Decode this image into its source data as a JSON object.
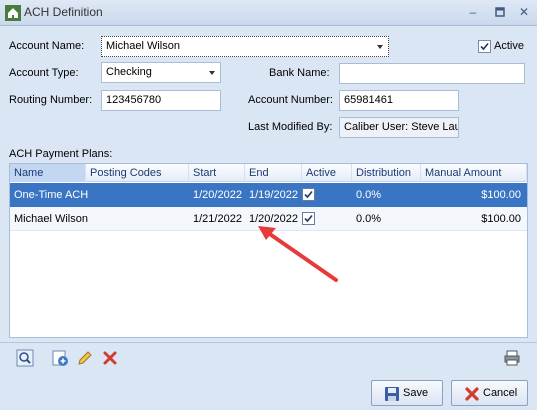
{
  "window": {
    "title": "ACH Definition",
    "minimize_glyph": "–",
    "maximize_glyph": "▫",
    "close_glyph": "✕"
  },
  "form": {
    "account_name_label": "Account Name:",
    "account_name_value": "Michael Wilson",
    "active_label": "Active",
    "active_checked": true,
    "account_type_label": "Account Type:",
    "account_type_value": "Checking",
    "bank_name_label": "Bank Name:",
    "bank_name_value": "",
    "routing_label": "Routing Number:",
    "routing_value": "123456780",
    "account_number_label": "Account Number:",
    "account_number_value": "65981461",
    "last_modified_label": "Last Modified By:",
    "last_modified_value": "Caliber User: Steve Lau"
  },
  "plans": {
    "section_label": "ACH Payment Plans:",
    "columns": [
      "Name",
      "Posting Codes",
      "Start",
      "End",
      "Active",
      "Distribution",
      "Manual Amount"
    ],
    "rows": [
      {
        "name": "One-Time ACH",
        "posting_codes": "",
        "start": "1/20/2022",
        "end": "1/19/2022",
        "active": true,
        "distribution": "0.0%",
        "manual_amount": "$100.00"
      },
      {
        "name": "Michael Wilson",
        "posting_codes": "",
        "start": "1/21/2022",
        "end": "1/20/2022",
        "active": true,
        "distribution": "0.0%",
        "manual_amount": "$100.00"
      }
    ],
    "selected_row": 0
  },
  "toolbar": {
    "icons": [
      "search-icon",
      "add-icon",
      "edit-icon",
      "delete-icon",
      "print-icon"
    ]
  },
  "buttons": {
    "save_label": "Save",
    "cancel_label": "Cancel"
  },
  "colors": {
    "selection": "#3a75c4",
    "annotation_arrow": "#e83a3a",
    "header_text": "#1b3a75"
  }
}
